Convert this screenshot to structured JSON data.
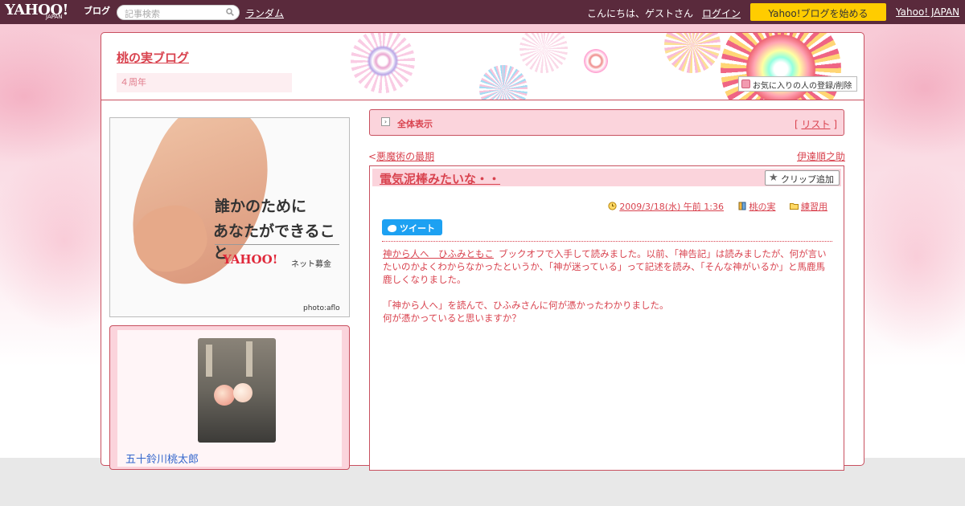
{
  "topbar": {
    "logo": "YAHOO!",
    "logo_sub": "JAPAN",
    "logo_blog": "ブログ",
    "search_placeholder": "記事検索",
    "random_link": "ランダム",
    "greeting": "こんにちは、ゲストさん",
    "login_link": "ログイン",
    "start_button": "Yahoo!ブログを始める",
    "yahoo_japan_link": "Yahoo! JAPAN"
  },
  "header": {
    "blog_title": "桃の実ブログ",
    "anniversary": "４周年",
    "favorite_button": "お気に入りの人の登録/削除"
  },
  "ad": {
    "line1": "誰かのために",
    "line2": "あなたができること",
    "logo": "YAHOO!",
    "logo_sub": "ネット募金",
    "credit": "photo:aflo"
  },
  "profile": {
    "name": "五十鈴川桃太郎"
  },
  "listbar": {
    "title": "全体表示",
    "link_open": "[",
    "link": "リスト",
    "link_close": "]"
  },
  "nav": {
    "prev_arrow": "<",
    "prev": "悪魔術の最期",
    "next": "伊達順之助",
    "next_arrow": ">"
  },
  "article": {
    "title": "電気泥棒みたいな・・",
    "clip_button": "クリップ追加",
    "datetime": "2009/3/18(水) 午前 1:36",
    "author": "桃の実",
    "category": "練習用",
    "tweet": "ツイート",
    "book_link": "神から人へ　ひふみともこ",
    "paragraph1": "ブックオフで入手して読みました。以前、「神告記」は読みましたが、何が言いたいのかよくわからなかったというか、「神が迷っている」って記述を読み、「そんな神がいるか」と馬鹿馬鹿しくなりました。",
    "paragraph2a": "「神から人へ」を読んで、ひふみさんに何が憑かったわかりました。",
    "paragraph2b": "何が憑かっていると思いますか？"
  },
  "colors": {
    "topbar": "#5a2a3c",
    "accent": "#d9434f",
    "pink_panel": "#fbd4dc",
    "start_button": "#ffcc00",
    "tweet": "#1da1f2"
  },
  "icons": [
    "search-icon",
    "list-icon",
    "clock-icon",
    "book-icon",
    "folder-icon",
    "star-icon",
    "twitter-bird-icon",
    "favorite-icon"
  ]
}
